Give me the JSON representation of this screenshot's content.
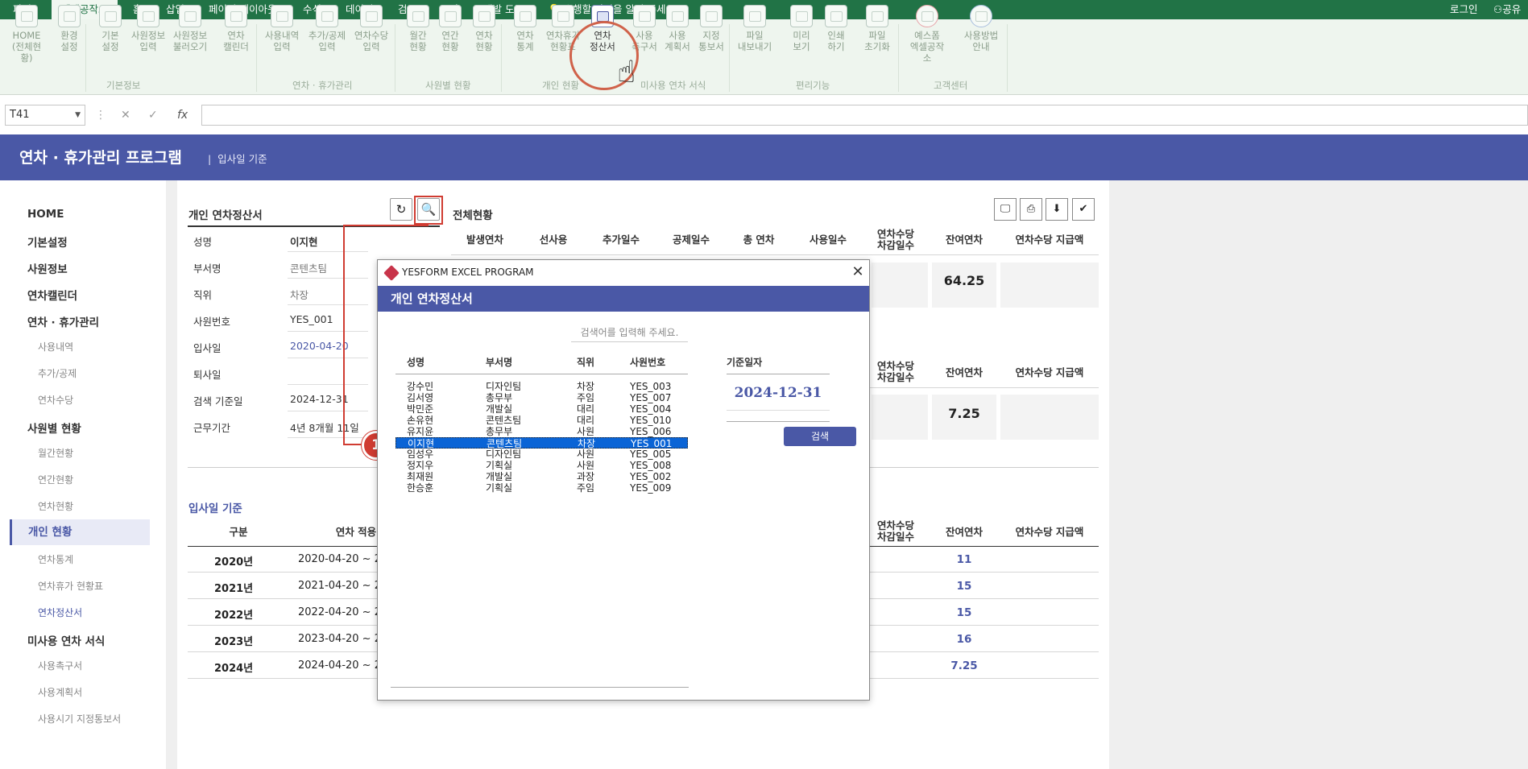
{
  "ribbon_tabs": [
    "파일",
    "엑셀공작소",
    "홈",
    "삽입",
    "페이지 레이아웃",
    "수식",
    "데이터",
    "검토",
    "보기",
    "개발 도구"
  ],
  "tell_me": "수행할 작업을 알려 주세요.",
  "login": "로그인",
  "share": "공유",
  "ribbon_buttons": [
    {
      "label1": "HOME",
      "label2": "(전체현황)"
    },
    {
      "label1": "환경",
      "label2": "설정"
    },
    {
      "label1": "기본",
      "label2": "설정"
    },
    {
      "label1": "사원정보",
      "label2": "입력"
    },
    {
      "label1": "사원정보",
      "label2": "불러오기"
    },
    {
      "label1": "연차",
      "label2": "캘린더"
    },
    {
      "label1": "사용내역",
      "label2": "입력"
    },
    {
      "label1": "추가/공제",
      "label2": "입력"
    },
    {
      "label1": "연차수당",
      "label2": "입력"
    },
    {
      "label1": "월간",
      "label2": "현황"
    },
    {
      "label1": "연간",
      "label2": "현황"
    },
    {
      "label1": "연차",
      "label2": "현황"
    },
    {
      "label1": "연차",
      "label2": "통계"
    },
    {
      "label1": "연차휴가",
      "label2": "현황표"
    },
    {
      "label1": "연차",
      "label2": "정산서"
    },
    {
      "label1": "사용",
      "label2": "촉구서"
    },
    {
      "label1": "사용",
      "label2": "계획서"
    },
    {
      "label1": "지정",
      "label2": "통보서"
    },
    {
      "label1": "파일",
      "label2": "내보내기"
    },
    {
      "label1": "미리",
      "label2": "보기"
    },
    {
      "label1": "인쇄",
      "label2": "하기"
    },
    {
      "label1": "파일",
      "label2": "초기화"
    },
    {
      "label1": "예스폼",
      "label2": "엑셀공작소"
    },
    {
      "label1": "사용방법",
      "label2": "안내"
    }
  ],
  "ribbon_groups": [
    "기본정보",
    "연차 · 휴가관리",
    "사원별 현황",
    "개인 현황",
    "미사용 연차 서식",
    "편리기능",
    "고객센터"
  ],
  "formula_bar": {
    "name_box": "T41",
    "cancel": "✕",
    "enter": "✓",
    "fx": "fx"
  },
  "banner": {
    "title": "연차 · 휴가관리 프로그램",
    "sub": "입사일 기준"
  },
  "sidebar": [
    {
      "label": "HOME",
      "level": 1
    },
    {
      "label": "기본설정",
      "level": 1
    },
    {
      "label": "사원정보",
      "level": 1
    },
    {
      "label": "연차캘린더",
      "level": 1
    },
    {
      "label": "연차 · 휴가관리",
      "level": 1
    },
    {
      "label": "사용내역",
      "level": 2
    },
    {
      "label": "추가/공제",
      "level": 2
    },
    {
      "label": "연차수당",
      "level": 2
    },
    {
      "label": "사원별 현황",
      "level": 1
    },
    {
      "label": "월간현황",
      "level": 2
    },
    {
      "label": "연간현황",
      "level": 2
    },
    {
      "label": "연차현황",
      "level": 2
    },
    {
      "label": "개인 현황",
      "level": 1
    },
    {
      "label": "연차통계",
      "level": 2
    },
    {
      "label": "연차휴가 현황표",
      "level": 2
    },
    {
      "label": "연차정산서",
      "level": 2
    },
    {
      "label": "미사용 연차 서식",
      "level": 1
    },
    {
      "label": "사용촉구서",
      "level": 2
    },
    {
      "label": "사용계획서",
      "level": 2
    },
    {
      "label": "사용시기 지정통보서",
      "level": 2
    }
  ],
  "personal": {
    "title": "개인 연차정산서",
    "fields": [
      {
        "label": "성명",
        "value": "이지현"
      },
      {
        "label": "부서명",
        "value": "콘텐츠팀"
      },
      {
        "label": "직위",
        "value": "차장"
      },
      {
        "label": "사원번호",
        "value": "YES_001"
      },
      {
        "label": "입사일",
        "value": "2020-04-20"
      },
      {
        "label": "퇴사일",
        "value": ""
      },
      {
        "label": "검색 기준일",
        "value": "2024-12-31"
      },
      {
        "label": "근무기간",
        "value": "4년 8개월 11일"
      }
    ]
  },
  "overview": {
    "title": "전체현황",
    "headers": [
      "발생연차",
      "선사용",
      "추가일수",
      "공제일수",
      "총 연차",
      "사용일수",
      "연차수당\n차감일수",
      "잔여연차",
      "연차수당 지급액"
    ],
    "remain1": "64.25",
    "remain2": "7.25",
    "header_a": "연차수당",
    "header_b": "차감일수",
    "remain_label": "잔여연차",
    "pay_label": "연차수당 지급액"
  },
  "by_hire": {
    "title": "입사일 기준",
    "col_gubun": "구분",
    "col_range": "연차 적용",
    "rows": [
      {
        "year": "2020년",
        "range": "2020-04-20 ~ 2",
        "remain": "11"
      },
      {
        "year": "2021년",
        "range": "2021-04-20 ~ 2",
        "remain": "15"
      },
      {
        "year": "2022년",
        "range": "2022-04-20 ~ 2",
        "remain": "15"
      },
      {
        "year": "2023년",
        "range": "2023-04-20 ~ 2",
        "remain": "16"
      },
      {
        "year": "2024년",
        "range": "2024-04-20 ~ 2",
        "remain": "7.25"
      }
    ]
  },
  "marker": "1",
  "dialog": {
    "app_title": "YESFORM EXCEL PROGRAM",
    "header": "개인 연차정산서",
    "search_placeholder": "검색어를 입력해 주세요.",
    "col_name": "성명",
    "col_dept": "부서명",
    "col_pos": "직위",
    "col_id": "사원번호",
    "rows": [
      {
        "name": "강수민",
        "dept": "디자인팀",
        "pos": "차장",
        "id": "YES_003"
      },
      {
        "name": "김서영",
        "dept": "총무부",
        "pos": "주임",
        "id": "YES_007"
      },
      {
        "name": "박민준",
        "dept": "개발실",
        "pos": "대리",
        "id": "YES_004"
      },
      {
        "name": "손유현",
        "dept": "콘텐츠팀",
        "pos": "대리",
        "id": "YES_010"
      },
      {
        "name": "유지윤",
        "dept": "총무부",
        "pos": "사원",
        "id": "YES_006"
      },
      {
        "name": "이지현",
        "dept": "콘텐츠팀",
        "pos": "차장",
        "id": "YES_001"
      },
      {
        "name": "임성우",
        "dept": "디자인팀",
        "pos": "사원",
        "id": "YES_005"
      },
      {
        "name": "정지우",
        "dept": "기획실",
        "pos": "사원",
        "id": "YES_008"
      },
      {
        "name": "최재원",
        "dept": "개발실",
        "pos": "과장",
        "id": "YES_002"
      },
      {
        "name": "한승훈",
        "dept": "기획실",
        "pos": "주임",
        "id": "YES_009"
      }
    ],
    "selected_index": 5,
    "date_label": "기준일자",
    "date": "2024-12-31",
    "search_button": "검색",
    "close": "✕"
  },
  "colors": {
    "excel_green": "#217346",
    "brand": "#4a58a6",
    "highlight": "#d03c32",
    "selection": "#0a64d6"
  }
}
